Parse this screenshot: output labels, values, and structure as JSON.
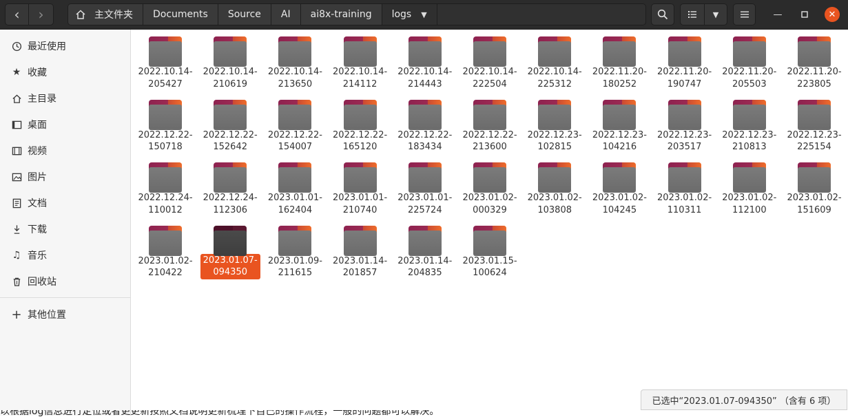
{
  "header": {
    "breadcrumbs": [
      "主文件夹",
      "Documents",
      "Source",
      "AI",
      "ai8x-training",
      "logs"
    ]
  },
  "sidebar": {
    "items": [
      {
        "label": "最近使用",
        "icon": "clock-icon"
      },
      {
        "label": "收藏",
        "icon": "star-icon"
      },
      {
        "label": "主目录",
        "icon": "home-icon"
      },
      {
        "label": "桌面",
        "icon": "desktop-icon"
      },
      {
        "label": "视频",
        "icon": "video-icon"
      },
      {
        "label": "图片",
        "icon": "image-icon"
      },
      {
        "label": "文档",
        "icon": "document-icon"
      },
      {
        "label": "下载",
        "icon": "download-icon"
      },
      {
        "label": "音乐",
        "icon": "music-icon"
      },
      {
        "label": "回收站",
        "icon": "trash-icon"
      }
    ],
    "other_locations": "其他位置"
  },
  "folders": [
    {
      "line1": "2022.10.14-",
      "line2": "205427"
    },
    {
      "line1": "2022.10.14-",
      "line2": "210619"
    },
    {
      "line1": "2022.10.14-",
      "line2": "213650"
    },
    {
      "line1": "2022.10.14-",
      "line2": "214112"
    },
    {
      "line1": "2022.10.14-",
      "line2": "214443"
    },
    {
      "line1": "2022.10.14-",
      "line2": "222504"
    },
    {
      "line1": "2022.10.14-",
      "line2": "225312"
    },
    {
      "line1": "2022.11.20-",
      "line2": "180252"
    },
    {
      "line1": "2022.11.20-",
      "line2": "190747"
    },
    {
      "line1": "2022.11.20-",
      "line2": "205503"
    },
    {
      "line1": "2022.11.20-",
      "line2": "223805"
    },
    {
      "line1": "2022.12.22-",
      "line2": "150718"
    },
    {
      "line1": "2022.12.22-",
      "line2": "152642"
    },
    {
      "line1": "2022.12.22-",
      "line2": "154007"
    },
    {
      "line1": "2022.12.22-",
      "line2": "165120"
    },
    {
      "line1": "2022.12.22-",
      "line2": "183434"
    },
    {
      "line1": "2022.12.22-",
      "line2": "213600"
    },
    {
      "line1": "2022.12.23-",
      "line2": "102815"
    },
    {
      "line1": "2022.12.23-",
      "line2": "104216"
    },
    {
      "line1": "2022.12.23-",
      "line2": "203517"
    },
    {
      "line1": "2022.12.23-",
      "line2": "210813"
    },
    {
      "line1": "2022.12.23-",
      "line2": "225154"
    },
    {
      "line1": "2022.12.24-",
      "line2": "110012"
    },
    {
      "line1": "2022.12.24-",
      "line2": "112306"
    },
    {
      "line1": "2023.01.01-",
      "line2": "162404"
    },
    {
      "line1": "2023.01.01-",
      "line2": "210740"
    },
    {
      "line1": "2023.01.01-",
      "line2": "225724"
    },
    {
      "line1": "2023.01.02-",
      "line2": "000329"
    },
    {
      "line1": "2023.01.02-",
      "line2": "103808"
    },
    {
      "line1": "2023.01.02-",
      "line2": "104245"
    },
    {
      "line1": "2023.01.02-",
      "line2": "110311"
    },
    {
      "line1": "2023.01.02-",
      "line2": "112100"
    },
    {
      "line1": "2023.01.02-",
      "line2": "151609"
    },
    {
      "line1": "2023.01.02-",
      "line2": "210422"
    },
    {
      "line1": "2023.01.07-",
      "line2": "094350",
      "selected": true
    },
    {
      "line1": "2023.01.09-",
      "line2": "211615"
    },
    {
      "line1": "2023.01.14-",
      "line2": "201857"
    },
    {
      "line1": "2023.01.14-",
      "line2": "204835"
    },
    {
      "line1": "2023.01.15-",
      "line2": "100624"
    }
  ],
  "status": "已选中“2023.01.07-094350” （含有 6 项）",
  "background_text": "以根据log信息进行定位或者更更新按照文档说明更新梳理下自己的操作流程，一般的问题都可以解决。",
  "colors": {
    "accent": "#e95420",
    "headerbar": "#2b2b2b",
    "folder_tab": "#8e2250"
  }
}
